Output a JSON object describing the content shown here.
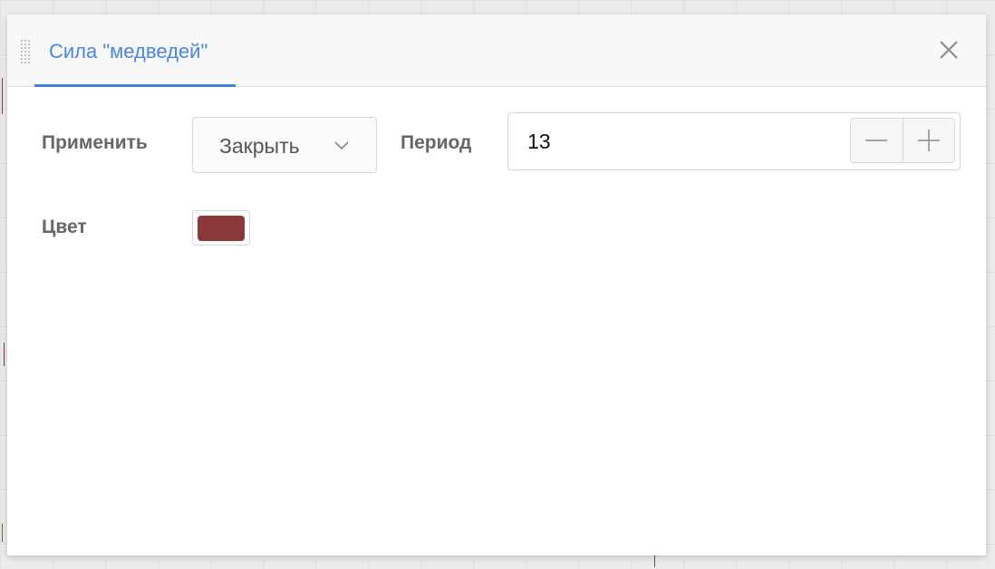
{
  "dialog": {
    "tab_label": "Сила \"медведей\"",
    "close_label": "×"
  },
  "fields": {
    "apply": {
      "label": "Применить",
      "value": "Закрыть"
    },
    "period": {
      "label": "Период",
      "value": "13",
      "decrement_icon": "minus-icon",
      "increment_icon": "plus-icon"
    },
    "color": {
      "label": "Цвет",
      "value": "#8b3a3a"
    }
  },
  "colors": {
    "accent": "#4a7fd9",
    "tab_text": "#4a86e0",
    "label_text": "#666666"
  }
}
